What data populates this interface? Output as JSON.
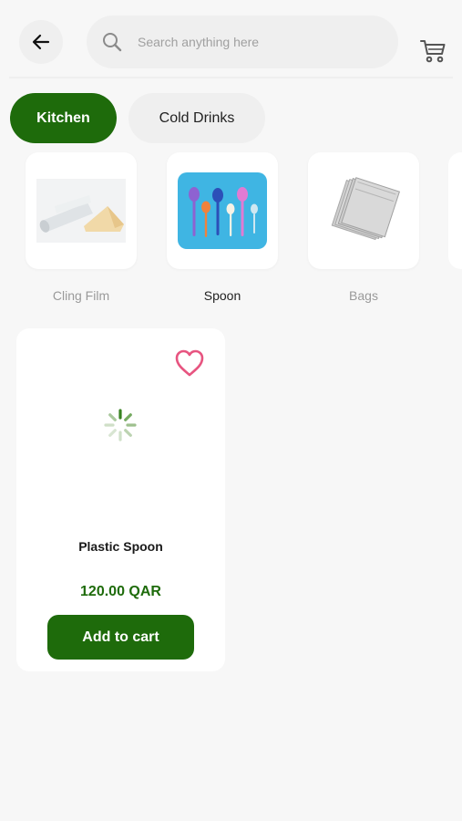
{
  "header": {
    "back_icon": "arrow-left-icon",
    "search": {
      "placeholder": "Search anything here",
      "icon": "search-icon"
    },
    "cart_icon": "cart-icon"
  },
  "tabs": [
    {
      "label": "Kitchen",
      "active": true
    },
    {
      "label": "Cold Drinks",
      "active": false
    }
  ],
  "subcategories": [
    {
      "label": "Cling Film",
      "selected": false
    },
    {
      "label": "Spoon",
      "selected": true
    },
    {
      "label": "Bags",
      "selected": false
    }
  ],
  "products": [
    {
      "name": "Plastic Spoon",
      "price": "120.00 QAR",
      "add_label": "Add to cart",
      "favorite_icon": "heart-outline-icon",
      "image_state": "loading"
    }
  ],
  "colors": {
    "primary": "#1e6b0b",
    "heart": "#e75480",
    "background": "#f7f7f7"
  }
}
